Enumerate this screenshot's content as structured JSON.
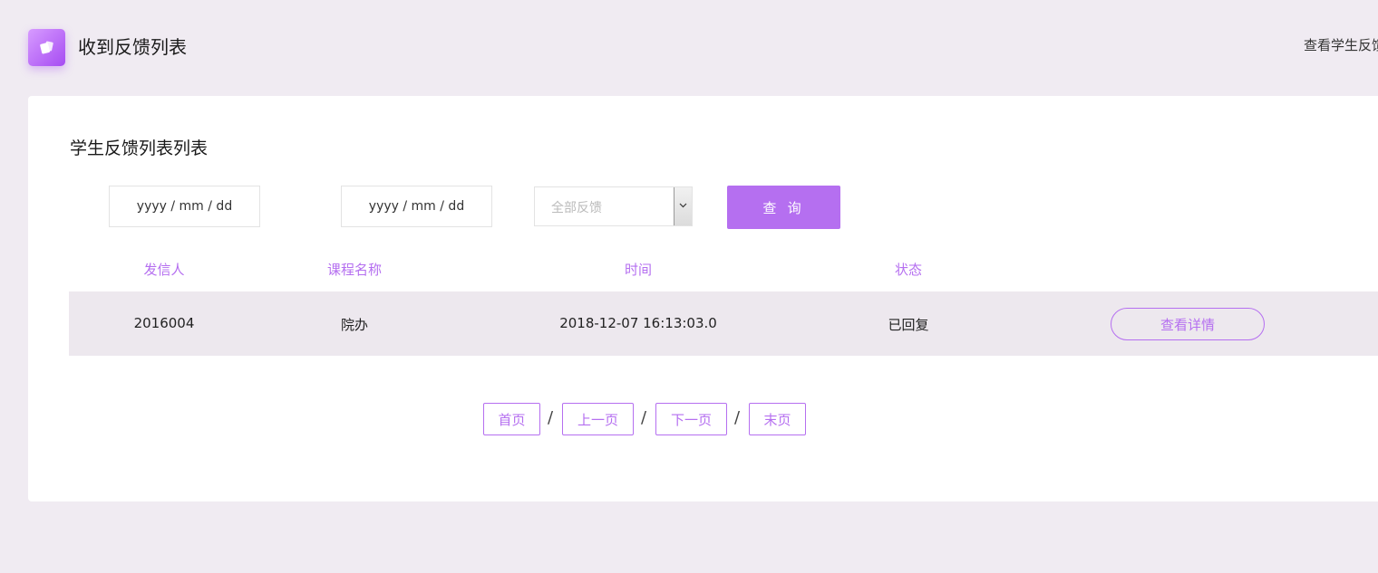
{
  "header": {
    "title": "收到反馈列表",
    "right_link": "查看学生反馈"
  },
  "card": {
    "section_title": "学生反馈列表列表",
    "filters": {
      "date_from_placeholder": "yyyy / mm / dd",
      "date_to_placeholder": "yyyy / mm / dd",
      "status_select_value": "全部反馈",
      "query_label": "查 询"
    },
    "table": {
      "headers": [
        "发信人",
        "课程名称",
        "时间",
        "状态"
      ],
      "rows": [
        {
          "sender": "2016004",
          "course": "院办",
          "time": "2018-12-07 16:13:03.0",
          "status": "已回复",
          "action_label": "查看详情"
        }
      ]
    },
    "pagination": {
      "first": "首页",
      "prev": "上一页",
      "next": "下一页",
      "last": "末页",
      "separator": "/"
    }
  },
  "colors": {
    "accent": "#b56ff0",
    "page_bg": "#f0ebf2",
    "row_bg": "#ede8ee"
  },
  "icons": {
    "logo": "feedback-cards-icon",
    "select_arrow": "chevron-down-icon"
  }
}
